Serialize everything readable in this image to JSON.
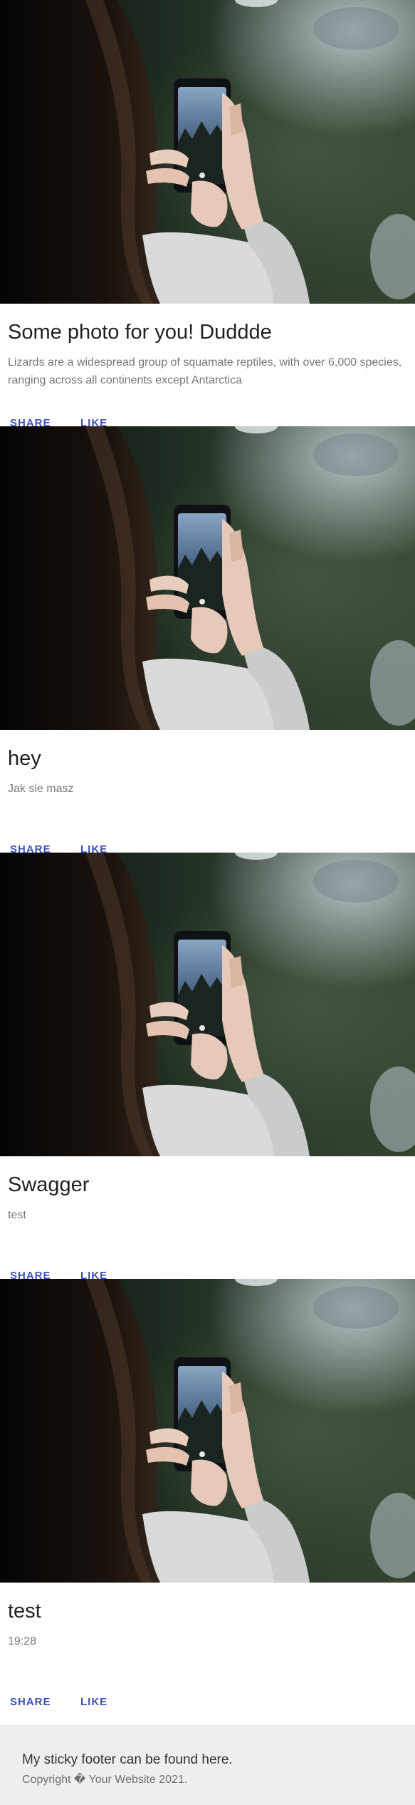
{
  "cards": [
    {
      "image_alt": "Woman taking a photo with a smartphone",
      "title": "Some photo for you! Duddde",
      "description": "Lizards are a widespread group of squamate reptiles, with over 6,000 species, ranging across all continents except Antarctica",
      "share_label": "SHARE",
      "like_label": "LIKE"
    },
    {
      "image_alt": "Woman taking a photo with a smartphone",
      "title": "hey",
      "description": "Jak sie masz",
      "share_label": "SHARE",
      "like_label": "LIKE"
    },
    {
      "image_alt": "Woman taking a photo with a smartphone",
      "title": "Swagger",
      "description": "test",
      "share_label": "SHARE",
      "like_label": "LIKE"
    },
    {
      "image_alt": "Woman taking a photo with a smartphone",
      "title": "test",
      "description": "19:28",
      "share_label": "SHARE",
      "like_label": "LIKE"
    }
  ],
  "footer": {
    "text": "My sticky footer can be found here.",
    "copyright": "Copyright � Your Website 2021."
  },
  "colors": {
    "button": "#3f51b5",
    "footer_bg": "#eeeeee"
  }
}
